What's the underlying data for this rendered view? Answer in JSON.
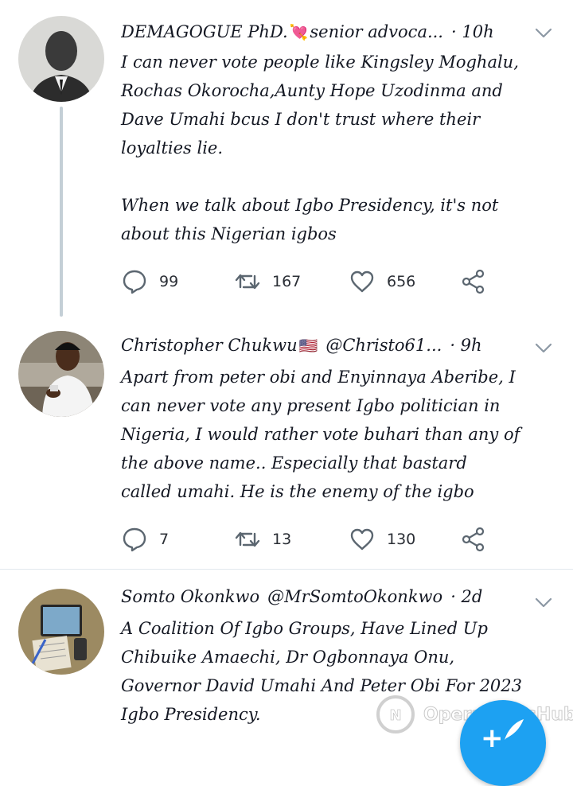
{
  "tweets": [
    {
      "name": "DEMAGOGUE PhD.",
      "emoji": "💘",
      "handle": "senior advoca...",
      "time": "· 10h",
      "text": "I can never vote people like Kingsley Moghalu,\nRochas Okorocha,Aunty Hope Uzodinma and\nDave Umahi bcus I don't trust where their\nloyalties lie.\n\nWhen we talk about Igbo Presidency, it's not\nabout this Nigerian igbos",
      "replies": "99",
      "retweets": "167",
      "likes": "656"
    },
    {
      "name": "Christopher Chukwu",
      "emoji": "🇺🇸",
      "handle": "@Christo61...",
      "time": "· 9h",
      "text": "Apart from peter obi and Enyinnaya Aberibe, I\ncan never vote any present Igbo politician in\nNigeria, I would rather vote buhari than any of\nthe above name.. Especially that bastard\ncalled umahi. He is the enemy of the igbo",
      "replies": "7",
      "retweets": "13",
      "likes": "130"
    },
    {
      "name": "Somto Okonkwo",
      "emoji": "",
      "handle": "@MrSomtoOkonkwo",
      "time": "· 2d",
      "text": "A Coalition Of Igbo Groups, Have Lined Up\nChibuike Amaechi, Dr Ogbonnaya Onu,\nGovernor David Umahi And Peter Obi For 2023\nIgbo Presidency."
    }
  ],
  "watermark": "OperaNewsHub",
  "colors": {
    "accent": "#1da1f2",
    "icon": "#5b6670",
    "divider": "#e1e8ed",
    "thread": "#c4cfd6"
  }
}
